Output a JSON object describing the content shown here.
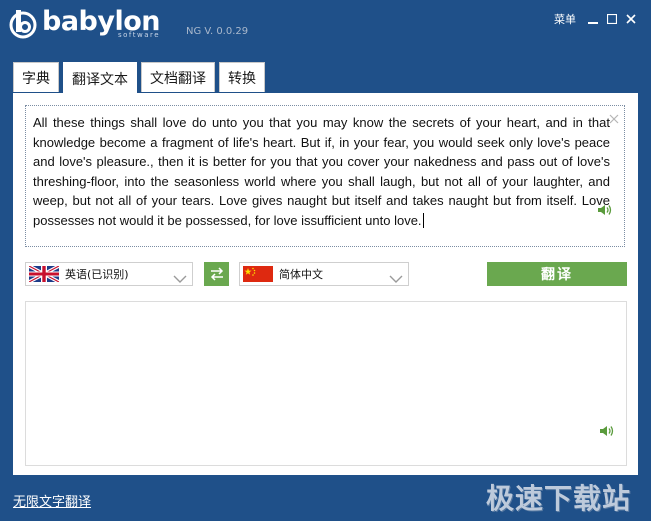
{
  "app": {
    "logo_text": "babylon",
    "logo_subtext": "software",
    "version": "NG V. 0.0.29",
    "menu_label": "菜单"
  },
  "tabs": [
    {
      "label": "字典",
      "active": false
    },
    {
      "label": "翻译文本",
      "active": true
    },
    {
      "label": "文档翻译",
      "active": false
    },
    {
      "label": "转换",
      "active": false
    }
  ],
  "source": {
    "text": "All these things shall love do unto you that you may know the secrets of your heart, and in that knowledge become a fragment of life's heart. But if, in your fear, you would seek only love's peace and love's pleasure., then it is better for you that you cover your nakedness and pass out of love's threshing-floor, into the seasonless world where you shall laugh, but not all of your laughter, and weep, but not all of your tears. Love gives naught but itself and takes naught but from itself. Love possesses not would it be possessed, for love issufficient unto love."
  },
  "languages": {
    "source_lang": "英语(已识别)",
    "target_lang": "简体中文",
    "source_flag_icon": "uk-flag-icon",
    "target_flag_icon": "china-flag-icon"
  },
  "actions": {
    "translate_label": "翻译"
  },
  "output": {
    "text": ""
  },
  "footer": {
    "link_label": "无限文字翻译",
    "watermark": "极速下载站"
  },
  "colors": {
    "background": "#1f5089",
    "accent_green": "#6aa84f",
    "panel": "#ffffff"
  }
}
